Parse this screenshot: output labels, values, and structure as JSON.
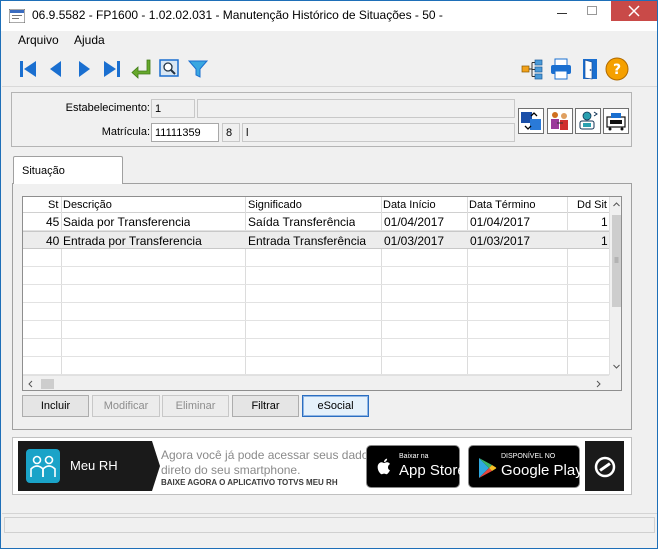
{
  "window": {
    "title": "06.9.5582 - FP1600 - 1.02.02.031 - Manutenção Histórico de Situações - 50 -"
  },
  "menu": {
    "items": [
      {
        "label": "Arquivo"
      },
      {
        "label": "Ajuda"
      }
    ]
  },
  "form": {
    "estabelecimento_label": "Estabelecimento:",
    "estabelecimento_code": "1",
    "estabelecimento_name": "",
    "matricula_label": "Matrícula:",
    "matricula_value": "11111359",
    "matricula_digit": "8",
    "matricula_name": "l"
  },
  "tab": {
    "label": "Situação"
  },
  "grid": {
    "columns": [
      "St",
      "Descrição",
      "Significado",
      "Data Início",
      "Data Término",
      "Dd Sit"
    ],
    "rows": [
      {
        "st": "45",
        "descricao": "Saida por Transferencia",
        "significado": "Saída Transferência",
        "data_inicio": "01/04/2017",
        "data_termino": "01/04/2017",
        "dd_sit": "1"
      },
      {
        "st": "40",
        "descricao": "Entrada por Transferencia",
        "significado": "Entrada Transferência",
        "data_inicio": "01/03/2017",
        "data_termino": "01/03/2017",
        "dd_sit": "1"
      }
    ]
  },
  "actions": {
    "incluir": "Incluir",
    "modificar": "Modificar",
    "eliminar": "Eliminar",
    "filtrar": "Filtrar",
    "esocial": "eSocial"
  },
  "banner": {
    "app_name": "Meu RH",
    "line1": "Agora você já pode acessar seus dados",
    "line2": "direto do seu smartphone.",
    "line3": "BAIXE AGORA O APLICATIVO TOTVS MEU RH",
    "appstore_small": "Baixar na",
    "appstore_big": "App Store",
    "googleplay_small": "DISPONÍVEL NO",
    "googleplay_big": "Google Play"
  },
  "colors": {
    "accent": "#1a6fd0",
    "close": "#c94a48",
    "banner_dark": "#1a1a1a",
    "meurh_teal": "#1aa3c8"
  }
}
